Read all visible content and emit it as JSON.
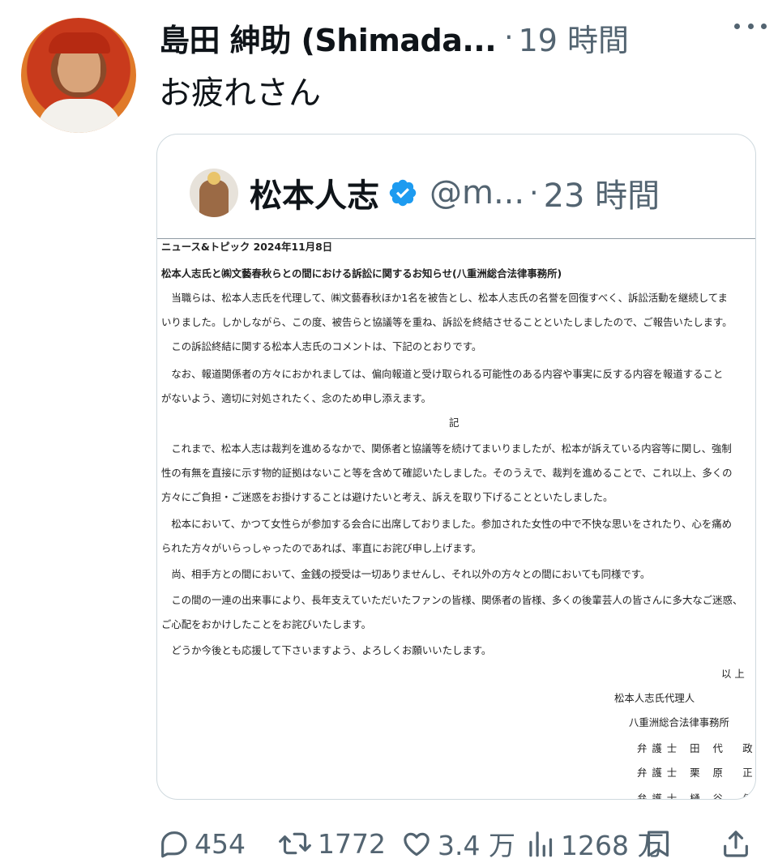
{
  "tweet": {
    "author_name": "島田 紳助 (Shimada...",
    "dot": "·",
    "time": "19 時間",
    "text": "お疲れさん",
    "icons": {
      "avatar": "user-avatar",
      "more": "more-options-icon"
    }
  },
  "quote": {
    "name": "松本人志",
    "handle": "@m...",
    "dot": "·",
    "time": "23 時間",
    "verified_color": "#1d9bf0",
    "document": {
      "lines": [
        "ニュース&トピック  2024年11月8日",
        "松本人志氏と㈱文藝春秋らとの間における訴訟に関するお知らせ(八重洲総合法律事務所)",
        "　当職らは、松本人志氏を代理して、㈱文藝春秋ほか1名を被告とし、松本人志氏の名誉を回復すべく、訴訟活動を継続してま",
        "いりました。しかしながら、この度、被告らと協議等を重ね、訴訟を終結させることといたしましたので、ご報告いたします。",
        "　この訴訟終結に関する松本人志氏のコメントは、下記のとおりです。",
        "　なお、報道関係者の方々におかれましては、偏向報道と受け取られる可能性のある内容や事実に反する内容を報道すること",
        "がないよう、適切に対処されたく、念のため申し添えます。",
        "記",
        "　これまで、松本人志は裁判を進めるなかで、関係者と協議等を続けてまいりましたが、松本が訴えている内容等に関し、強制",
        "性の有無を直接に示す物的証拠はないこと等を含めて確認いたしました。そのうえで、裁判を進めることで、これ以上、多くの",
        "方々にご負担・ご迷惑をお掛けすることは避けたいと考え、訴えを取り下げることといたしました。",
        "　松本において、かつて女性らが参加する会合に出席しておりました。参加された女性の中で不快な思いをされたり、心を痛め",
        "られた方々がいらっしゃったのであれば、率直にお詫び申し上げます。",
        "　尚、相手方との間において、金銭の授受は一切ありませんし、それ以外の方々との間においても同様です。",
        "　この間の一連の出来事により、長年支えていただいたファンの皆様、関係者の皆様、多くの後輩芸人の皆さんに多大なご迷惑、",
        "ご心配をおかけしたことをお詫びいたします。",
        "　どうか今後とも応援して下さいますよう、よろしくお願いいたします。"
      ],
      "closing": "以 上",
      "agent": "松本人志氏代理人",
      "firm": "八重洲総合法律事務所",
      "lawyers": [
        "弁護士 田 代　政 弘",
        "弁護士 栗 原　正 晴",
        "弁護士 樋 谷　倭 子"
      ]
    }
  },
  "actions": {
    "reply": {
      "icon": "reply-icon",
      "count": "454"
    },
    "retweet": {
      "icon": "retweet-icon",
      "count": "1772"
    },
    "like": {
      "icon": "like-icon",
      "count": "3.4 万"
    },
    "views": {
      "icon": "views-icon",
      "count": "1268 万"
    },
    "bookmark": {
      "icon": "bookmark-icon"
    },
    "share": {
      "icon": "share-icon"
    }
  }
}
